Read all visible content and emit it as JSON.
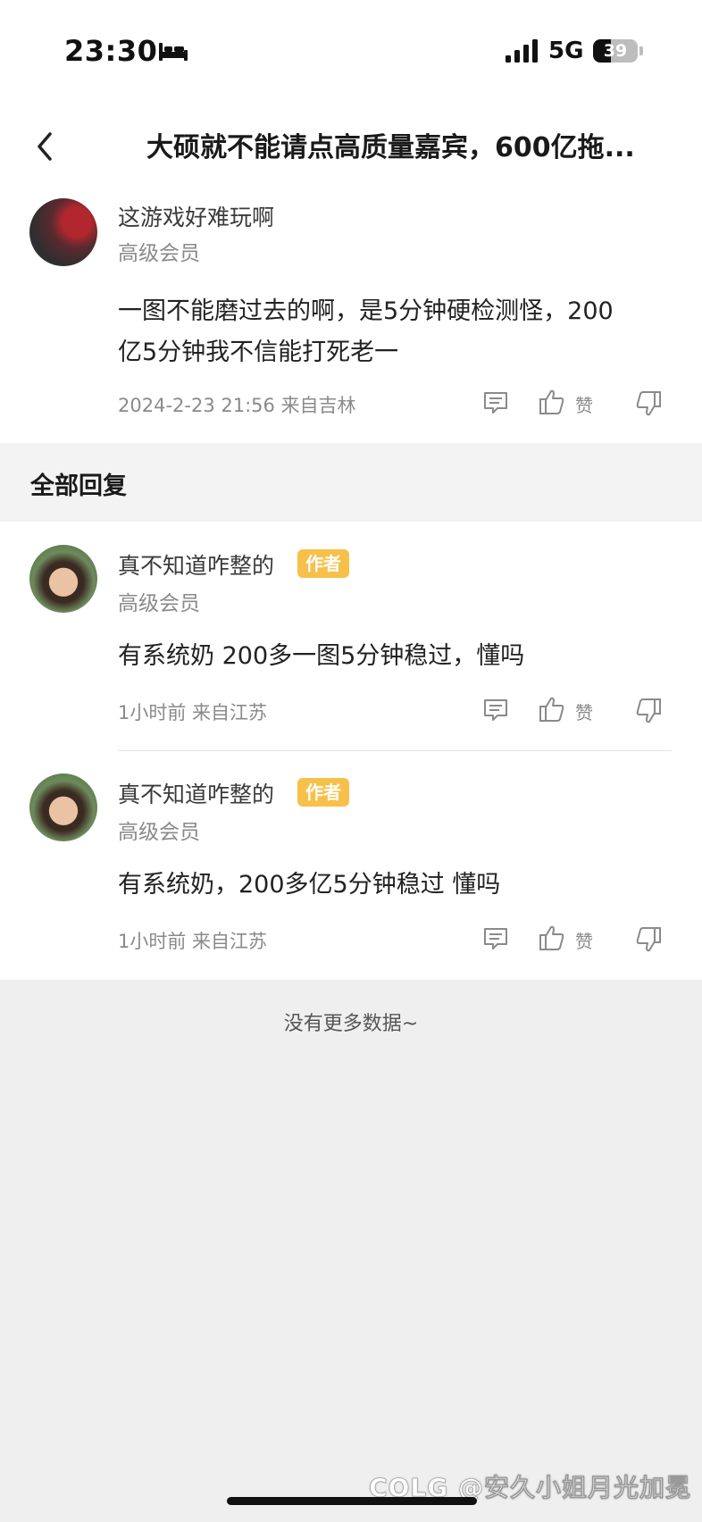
{
  "status_bar": {
    "time": "23:30",
    "network": "5G",
    "battery": "39",
    "battery_level": 0.39
  },
  "nav": {
    "title": "大硕就不能请点高质量嘉宾，600亿拖..."
  },
  "post": {
    "username": "这游戏好难玩啊",
    "level": "高级会员",
    "body_line1": "一图不能磨过去的啊，是5分钟硬检测怪，200",
    "body_line2": "亿5分钟我不信能打死老一",
    "meta": "2024-2-23 21:56 来自吉林",
    "like_label": "赞"
  },
  "section": {
    "title": "全部回复"
  },
  "replies": [
    {
      "username": "真不知道咋整的",
      "badge": "作者",
      "level": "高级会员",
      "body": "有系统奶 200多一图5分钟稳过，懂吗",
      "meta": "1小时前 来自江苏",
      "like_label": "赞"
    },
    {
      "username": "真不知道咋整的",
      "badge": "作者",
      "level": "高级会员",
      "body": "有系统奶，200多亿5分钟稳过  懂吗",
      "meta": "1小时前 来自江苏",
      "like_label": "赞"
    }
  ],
  "footer": {
    "no_more": "没有更多数据~"
  },
  "watermark": "COLG @安久小姐月光加冕",
  "colors": {
    "badge": "#f7c04a",
    "icon": "#8a8a8a",
    "background": "#efefef"
  },
  "icons": [
    "bed-icon",
    "signal-icon",
    "battery-icon",
    "back-icon",
    "comment-icon",
    "thumbs-up-icon",
    "thumbs-down-icon"
  ]
}
